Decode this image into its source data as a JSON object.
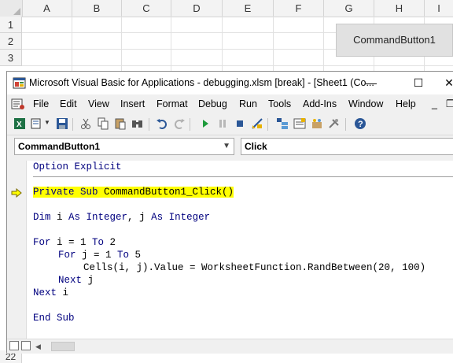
{
  "excel": {
    "columns": [
      "A",
      "B",
      "C",
      "D",
      "E",
      "F",
      "G",
      "H",
      "I"
    ],
    "rows": [
      "1",
      "2",
      "3"
    ],
    "bottom_row": "22",
    "command_button": "CommandButton1"
  },
  "vba": {
    "title": "Microsoft Visual Basic for Applications - debugging.xlsm [break] - [Sheet1 (Co...",
    "window_controls": {
      "minimize": "—",
      "maximize": "☐",
      "close": "✕"
    },
    "menu": {
      "file": "File",
      "edit": "Edit",
      "view": "View",
      "insert": "Insert",
      "format": "Format",
      "debug": "Debug",
      "run": "Run",
      "tools": "Tools",
      "addins": "Add-Ins",
      "window": "Window",
      "help": "Help",
      "doc_min": "_",
      "doc_restore": "❐"
    },
    "object_combo": "CommandButton1",
    "procedure_combo": "Click",
    "code": {
      "l1_kw": "Option Explicit",
      "l2_kw1": "Private Sub",
      "l2_rest": " CommandButton1_Click()",
      "l3_kw1": "Dim",
      "l3_t1": " i ",
      "l3_kw2": "As Integer",
      "l3_t2": ", j ",
      "l3_kw3": "As Integer",
      "l4_kw1": "For",
      "l4_t1": " i = 1 ",
      "l4_kw2": "To",
      "l4_t2": " 2",
      "l5_kw1": "For",
      "l5_t1": " j = 1 ",
      "l5_kw2": "To",
      "l5_t2": " 5",
      "l6": "Cells(i, j).Value = WorksheetFunction.RandBetween(20, 100)",
      "l7_kw": "Next",
      "l7_t": " j",
      "l8_kw": "Next",
      "l8_t": " i",
      "l9_kw": "End Sub"
    },
    "colors": {
      "keyword": "#00007f",
      "highlight": "#ffff00",
      "exec_arrow": "#ffff00"
    }
  }
}
